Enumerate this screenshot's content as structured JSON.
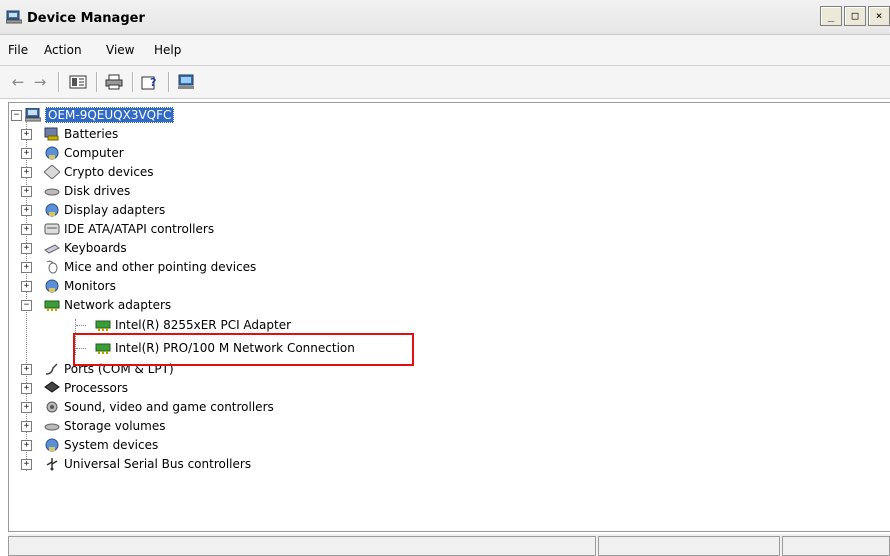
{
  "window": {
    "title": "Device Manager",
    "buttons": [
      "_",
      "□",
      "×"
    ]
  },
  "menu": [
    "File",
    "Action",
    "View",
    "Help"
  ],
  "toolbar": [
    {
      "name": "back-icon",
      "glyph": "←"
    },
    {
      "name": "forward-icon",
      "glyph": "→"
    },
    {
      "name": "properties-icon",
      "glyph": "▦"
    },
    {
      "name": "print-icon",
      "glyph": "⎙"
    },
    {
      "name": "help-icon",
      "glyph": "?"
    },
    {
      "name": "scan-hardware-icon",
      "glyph": "▣"
    }
  ],
  "tree": {
    "root": {
      "label": "OEM-9QEUQX3VQFC"
    },
    "categories": [
      {
        "label": "Batteries",
        "icon": "battery-icon"
      },
      {
        "label": "Computer",
        "icon": "computer-icon"
      },
      {
        "label": "Crypto devices",
        "icon": "crypto-icon"
      },
      {
        "label": "Disk drives",
        "icon": "disk-drive-icon"
      },
      {
        "label": "Display adapters",
        "icon": "display-adapter-icon"
      },
      {
        "label": "IDE ATA/ATAPI controllers",
        "icon": "ide-controller-icon"
      },
      {
        "label": "Keyboards",
        "icon": "keyboard-icon"
      },
      {
        "label": "Mice and other pointing devices",
        "icon": "mouse-icon"
      },
      {
        "label": "Monitors",
        "icon": "monitor-icon"
      },
      {
        "label": "Network adapters",
        "icon": "network-adapter-icon",
        "expanded": true,
        "children": [
          {
            "label": "Intel(R) 8255xER PCI Adapter"
          },
          {
            "label": "Intel(R) PRO/100 M Network Connection"
          }
        ]
      },
      {
        "label": "Ports (COM & LPT)",
        "icon": "port-icon"
      },
      {
        "label": "Processors",
        "icon": "processor-icon"
      },
      {
        "label": "Sound, video and game controllers",
        "icon": "sound-icon"
      },
      {
        "label": "Storage volumes",
        "icon": "storage-volume-icon"
      },
      {
        "label": "System devices",
        "icon": "system-device-icon"
      },
      {
        "label": "Universal Serial Bus controllers",
        "icon": "usb-icon"
      }
    ]
  }
}
